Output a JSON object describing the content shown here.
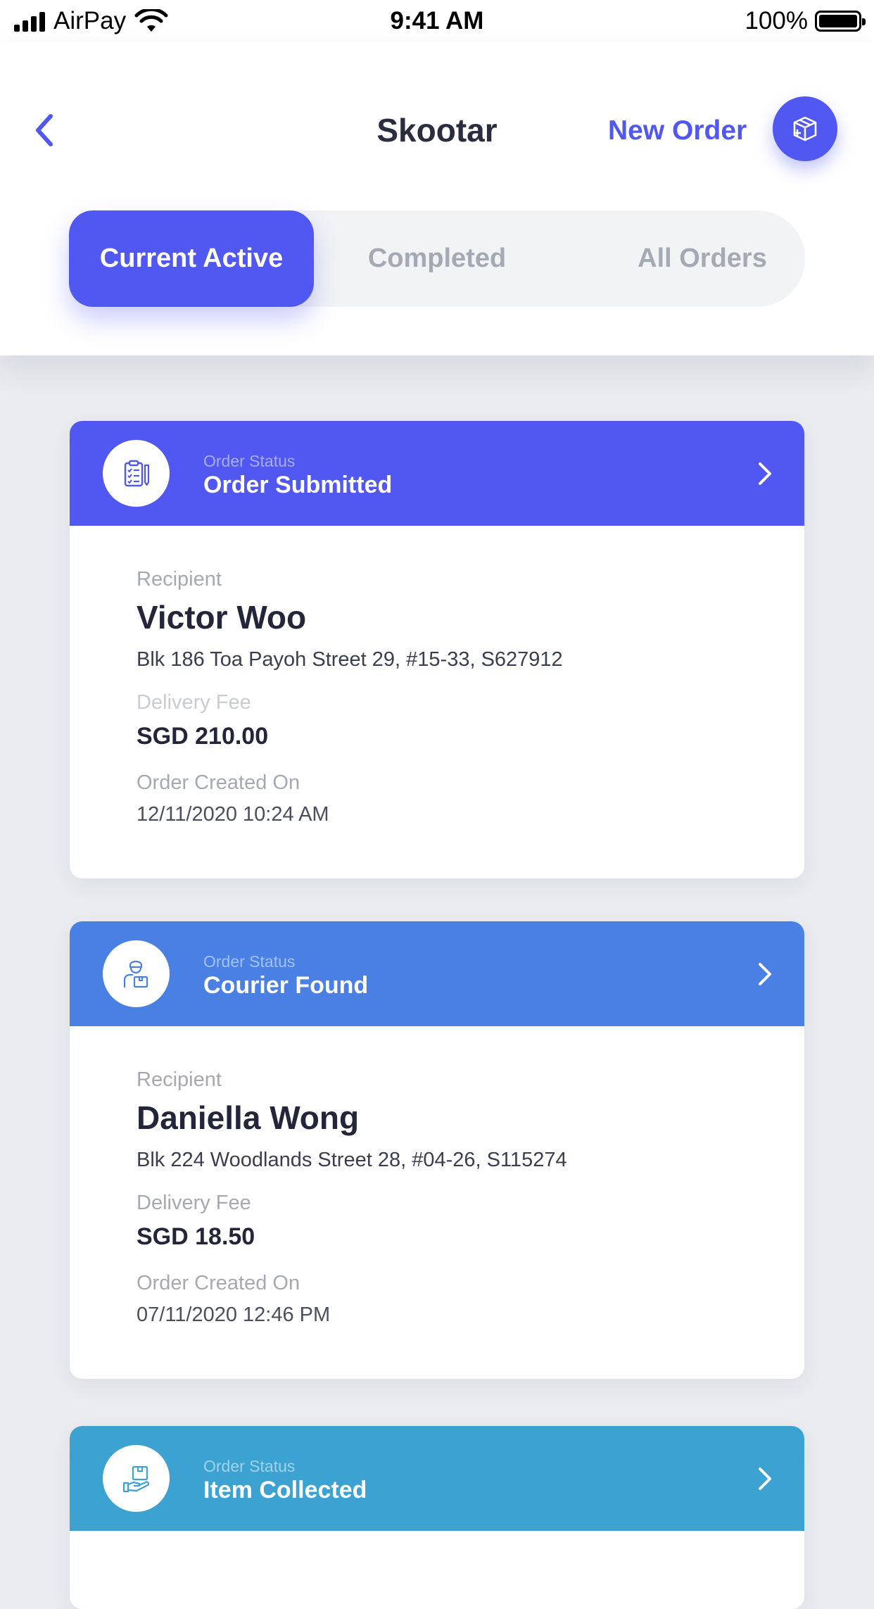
{
  "status_bar": {
    "carrier": "AirPay",
    "time": "9:41 AM",
    "battery": "100%"
  },
  "header": {
    "title": "Skootar",
    "new_order_label": "New Order",
    "back_icon": "chevron-left-icon",
    "new_order_icon": "package-add-icon"
  },
  "tabs": [
    {
      "label": "Current Active",
      "active": true
    },
    {
      "label": "Completed",
      "active": false
    },
    {
      "label": "All Orders",
      "active": false
    }
  ],
  "colors": {
    "accent": "#5158f2",
    "courier_found": "#4a7fe4",
    "item_collected": "#3ba2d2"
  },
  "orders": [
    {
      "status_label": "Order Status",
      "status": "Order Submitted",
      "status_icon": "clipboard-icon",
      "color": "#5158f2",
      "recipient_label": "Recipient",
      "recipient": "Victor Woo",
      "address": "Blk 186 Toa Payoh Street 29, #15-33, S627912",
      "fee_label": "Delivery Fee",
      "fee": "SGD 210.00",
      "created_label": "Order Created On",
      "created": "12/11/2020 10:24 AM"
    },
    {
      "status_label": "Order Status",
      "status": "Courier Found",
      "status_icon": "courier-icon",
      "color": "#4a7fe4",
      "recipient_label": "Recipient",
      "recipient": "Daniella Wong",
      "address": "Blk 224 Woodlands Street 28, #04-26, S115274",
      "fee_label": "Delivery Fee",
      "fee": "SGD 18.50",
      "created_label": "Order Created On",
      "created": "07/11/2020 12:46 PM"
    },
    {
      "status_label": "Order Status",
      "status": "Item Collected",
      "status_icon": "hand-package-icon",
      "color": "#3ba2d2"
    }
  ]
}
